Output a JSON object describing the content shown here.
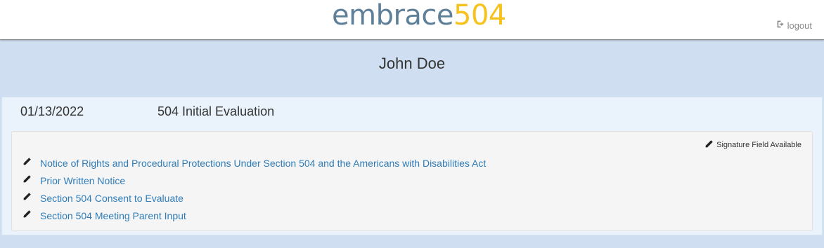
{
  "header": {
    "logo_word": "embrace",
    "logo_number": "504",
    "logout_label": "logout"
  },
  "student": {
    "name": "John Doe"
  },
  "evaluation": {
    "date": "01/13/2022",
    "type": "504 Initial Evaluation",
    "signature_note": "Signature Field Available",
    "forms": [
      {
        "label": "Notice of Rights and Procedural Protections Under Section 504 and the Americans with Disabilities Act",
        "icon": "pencil-icon"
      },
      {
        "label": "Prior Written Notice",
        "icon": "pencil-icon"
      },
      {
        "label": "Section 504 Consent to Evaluate",
        "icon": "pencil-icon"
      },
      {
        "label": "Section 504 Meeting Parent Input",
        "icon": "pencil-icon"
      }
    ]
  },
  "colors": {
    "page_background": "#cfdff1",
    "logo_word": "#5d7f98",
    "logo_number": "#f6c21b",
    "link": "#2f7cb7"
  }
}
